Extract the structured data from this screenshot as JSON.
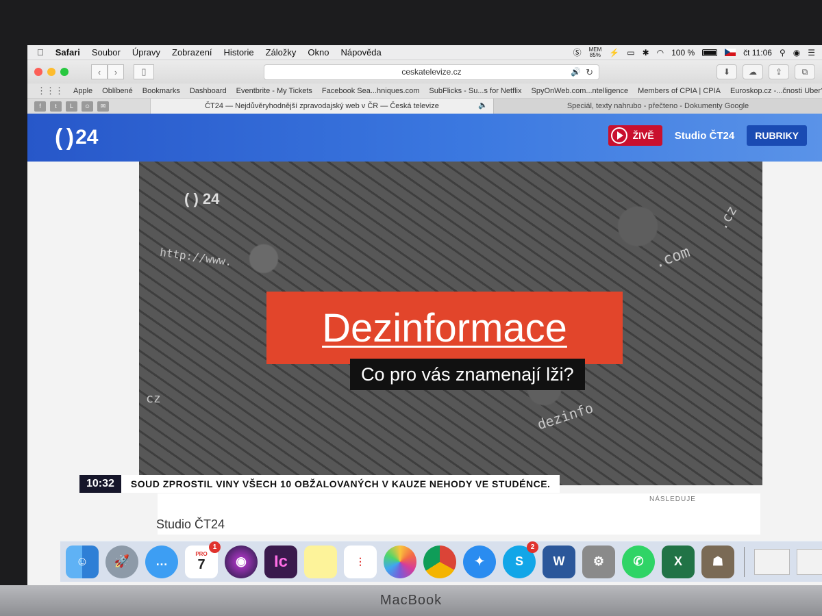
{
  "menubar": {
    "app": "Safari",
    "items": [
      "Soubor",
      "Úpravy",
      "Zobrazení",
      "Historie",
      "Záložky",
      "Okno",
      "Nápověda"
    ],
    "mem_label": "MEM",
    "mem_value": "85%",
    "battery": "100 %",
    "clock": "čt 11:06"
  },
  "toolbar": {
    "url": "ceskatelevize.cz"
  },
  "bookmarks": [
    "Apple",
    "Oblíbené",
    "Bookmarks",
    "Dashboard",
    "Eventbrite - My Tickets",
    "Facebook Sea...hniques.com",
    "SubFlicks - Su...s for Netflix",
    "SpyOnWeb.com...ntelligence",
    "Members of CPIA | CPIA",
    "Euroskop.cz -...čnosti Uber?"
  ],
  "tabs": {
    "active": "ČT24 — Nejdůvěryhodnější zpravodajský web v ČR — Česká televize",
    "inactive": "Speciál, texty nahrubo - přečteno - Dokumenty Google"
  },
  "header": {
    "logo_number": "24",
    "live_label": "ŽIVĚ",
    "studio_label": "Studio ČT24",
    "rubriky_label": "RUBRIKY"
  },
  "video": {
    "logo_number": "24",
    "title": "Dezinformace",
    "subtitle": "Co pro vás znamenají lži?",
    "ticker_time": "10:32",
    "ticker_text": "SOUD ZPROSTIL VINY VŠECH 10 OBŽALOVANÝCH V KAUZE NEHODY VE STUDÉNCE.",
    "doodles": [
      "http://www.",
      ".com",
      ".cz",
      "cz",
      "dezinfo"
    ]
  },
  "below": {
    "studio_caption": "Studio ČT24",
    "next_label": "NÁSLEDUJE"
  },
  "dock": {
    "calendar_month": "PRO",
    "calendar_day": "7",
    "calendar_badge": "1",
    "skype_badge": "2"
  },
  "laptop": {
    "brand": "MacBook"
  },
  "colors": {
    "ct_blue": "#2757c9",
    "live_red": "#c9102e",
    "title_orange": "#e2452b"
  }
}
